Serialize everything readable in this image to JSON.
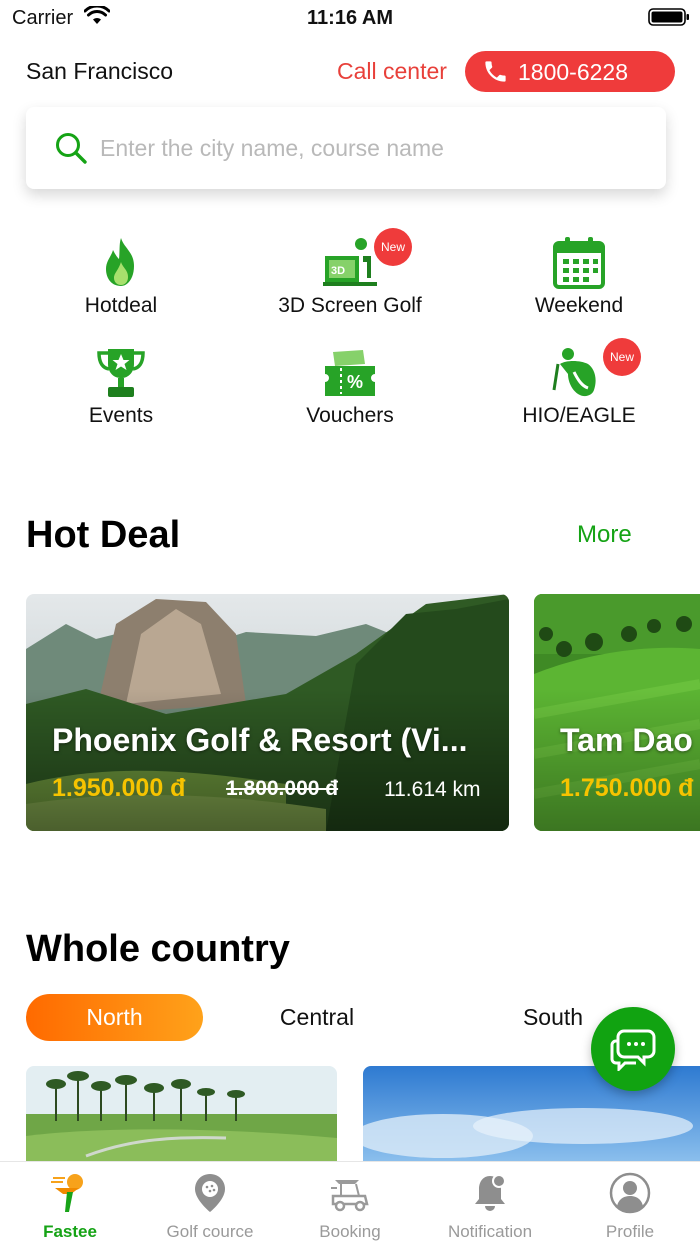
{
  "status_bar": {
    "carrier": "Carrier",
    "time": "11:16 AM"
  },
  "header": {
    "city": "San Francisco",
    "call_center_label": "Call center",
    "phone_number": "1800-6228"
  },
  "search": {
    "placeholder": "Enter the city name, course name"
  },
  "categories": [
    {
      "label": "Hotdeal",
      "icon": "flame-icon",
      "badge": ""
    },
    {
      "label": "3D Screen Golf",
      "icon": "3d-screen-golf-icon",
      "badge": "New"
    },
    {
      "label": "Weekend",
      "icon": "calendar-icon",
      "badge": ""
    },
    {
      "label": "Events",
      "icon": "trophy-icon",
      "badge": ""
    },
    {
      "label": "Vouchers",
      "icon": "voucher-icon",
      "badge": ""
    },
    {
      "label": "HIO/EAGLE",
      "icon": "golfer-icon",
      "badge": "New"
    }
  ],
  "hot_deal": {
    "title": "Hot Deal",
    "more_label": "More",
    "deals": [
      {
        "name": "Phoenix Golf & Resort (Vi...",
        "price": "1.950.000 đ",
        "old_price": "1.800.000 đ",
        "distance": "11.614 km"
      },
      {
        "name": "Tam Dao",
        "price": "1.750.000 đ",
        "old_price": "",
        "distance": ""
      }
    ]
  },
  "whole_country": {
    "title": "Whole country",
    "tabs": [
      "North",
      "Central",
      "South"
    ],
    "active_tab": "North"
  },
  "tab_bar": {
    "items": [
      {
        "label": "Fastee",
        "icon": "fastee-logo-icon",
        "active": true
      },
      {
        "label": "Golf cource",
        "icon": "map-pin-icon",
        "active": false
      },
      {
        "label": "Booking",
        "icon": "golf-cart-icon",
        "active": false
      },
      {
        "label": "Notification",
        "icon": "bell-icon",
        "active": false
      },
      {
        "label": "Profile",
        "icon": "user-icon",
        "active": false
      }
    ]
  },
  "colors": {
    "brand_green": "#15a315",
    "accent_red": "#ef3b3b",
    "price_yellow": "#f6c300",
    "tab_orange": "#ff6a00"
  }
}
